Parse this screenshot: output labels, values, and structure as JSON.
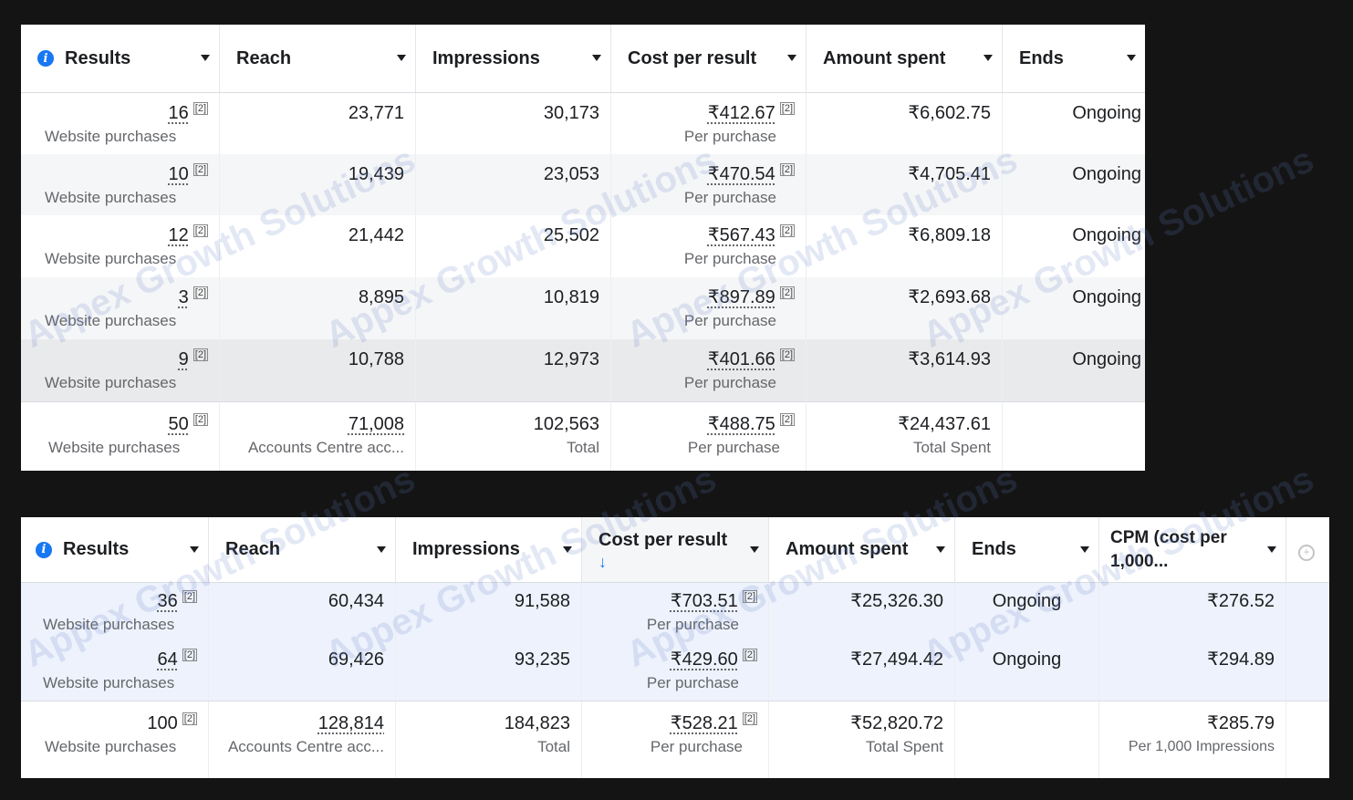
{
  "table1": {
    "headers": [
      "Results",
      "Reach",
      "Impressions",
      "Cost per result",
      "Amount spent",
      "Ends"
    ],
    "rows": [
      {
        "results": "16",
        "results_sub": "Website purchases",
        "reach": "23,771",
        "impressions": "30,173",
        "cost": "₹412.67",
        "cost_sub": "Per purchase",
        "spent": "₹6,602.75",
        "ends": "Ongoing"
      },
      {
        "results": "10",
        "results_sub": "Website purchases",
        "reach": "19,439",
        "impressions": "23,053",
        "cost": "₹470.54",
        "cost_sub": "Per purchase",
        "spent": "₹4,705.41",
        "ends": "Ongoing"
      },
      {
        "results": "12",
        "results_sub": "Website purchases",
        "reach": "21,442",
        "impressions": "25,502",
        "cost": "₹567.43",
        "cost_sub": "Per purchase",
        "spent": "₹6,809.18",
        "ends": "Ongoing"
      },
      {
        "results": "3",
        "results_sub": "Website purchases",
        "reach": "8,895",
        "impressions": "10,819",
        "cost": "₹897.89",
        "cost_sub": "Per purchase",
        "spent": "₹2,693.68",
        "ends": "Ongoing"
      },
      {
        "results": "9",
        "results_sub": "Website purchases",
        "reach": "10,788",
        "impressions": "12,973",
        "cost": "₹401.66",
        "cost_sub": "Per purchase",
        "spent": "₹3,614.93",
        "ends": "Ongoing"
      }
    ],
    "totals": {
      "results": "50",
      "results_sub": "Website purchases",
      "reach": "71,008",
      "reach_sub": "Accounts Centre acc...",
      "impressions": "102,563",
      "impressions_sub": "Total",
      "cost": "₹488.75",
      "cost_sub": "Per purchase",
      "spent": "₹24,437.61",
      "spent_sub": "Total Spent"
    }
  },
  "table2": {
    "headers": [
      "Results",
      "Reach",
      "Impressions",
      "Cost per result",
      "Amount spent",
      "Ends",
      "CPM (cost per 1,000..."
    ],
    "rows": [
      {
        "results": "36",
        "results_sub": "Website purchases",
        "reach": "60,434",
        "impressions": "91,588",
        "cost": "₹703.51",
        "cost_sub": "Per purchase",
        "spent": "₹25,326.30",
        "ends": "Ongoing",
        "cpm": "₹276.52"
      },
      {
        "results": "64",
        "results_sub": "Website purchases",
        "reach": "69,426",
        "impressions": "93,235",
        "cost": "₹429.60",
        "cost_sub": "Per purchase",
        "spent": "₹27,494.42",
        "ends": "Ongoing",
        "cpm": "₹294.89"
      }
    ],
    "totals": {
      "results": "100",
      "results_sub": "Website purchases",
      "reach": "128,814",
      "reach_sub": "Accounts Centre acc...",
      "impressions": "184,823",
      "impressions_sub": "Total",
      "cost": "₹528.21",
      "cost_sub": "Per purchase",
      "spent": "₹52,820.72",
      "spent_sub": "Total Spent",
      "cpm": "₹285.79",
      "cpm_sub": "Per 1,000 Impressions"
    }
  },
  "footnote_marker": "[2]",
  "watermark": "Appex Growth Solutions",
  "icons": {
    "info": "info-icon",
    "sort": "sort-down-arrow-icon",
    "dropdown": "caret-down-icon",
    "settings": "column-settings-icon"
  },
  "colors": {
    "row_alt": "#f5f6f7",
    "row_selected": "#eaeaea",
    "row_highlight": "#edf2fc",
    "info_blue": "#1877f2",
    "background": "#141414"
  }
}
